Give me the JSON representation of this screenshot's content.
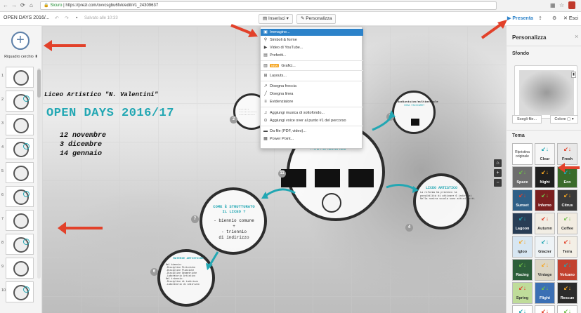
{
  "browser": {
    "nav_icons": [
      "back-icon",
      "forward-icon",
      "reload-icon"
    ],
    "secure_label": "Sicuro",
    "url": "https://prezi.com/ovvcsgbu6fvk/edit/#1_24309637",
    "right_icons": [
      "extension-icon",
      "star-icon",
      "profile-icon"
    ]
  },
  "toolbar": {
    "doc_title": "OPEN DAYS 2016/...",
    "saved_text": "Salvato alle 10:33",
    "insert_label": "Inserisci",
    "customize_label": "Personalizza",
    "present_label": "Presenta",
    "exit_label": "Esci"
  },
  "left_panel": {
    "add_icon": "+",
    "frame_label": "Riquadro cerchio",
    "frame_caret": "⬍",
    "thumb_numbers": [
      "1",
      "2",
      "3",
      "4",
      "5",
      "6",
      "7",
      "8",
      "9",
      "10"
    ]
  },
  "canvas": {
    "school": "Liceo Artistico \"N. Valentini\"",
    "title": "OPEN DAYS 2016/17",
    "dates": [
      "12 novembre",
      "3 dicembre",
      "14 gennaio"
    ],
    "center_title": "MULTIMEDIALE",
    "structure_heading": [
      "COME È STRUTTURATO",
      "IL LICEO ?"
    ],
    "structure_lines": [
      "- biennio comune",
      "+",
      "- triennio",
      "di indirizzo"
    ],
    "artistic_title": "LICEO ARTISTICO",
    "artistic_text": [
      "La riforma ha previsto la",
      "possibilità di attivare 6 indirizzi",
      "",
      "Nella nostra scuola sono attivi tutti"
    ],
    "materie_title": "MATERIE ARTISTICHE",
    "materie_text": [
      "Nel biennio:",
      "-Discipline Pittoriche",
      "-Discipline Plastiche",
      "-Discipline Geometriche",
      "-Laboratorio Artistico",
      "",
      "Nel triennio:",
      "-Discipline di indirizzo",
      "-Laboratorio di indirizzo"
    ],
    "audio_title": "Audiovisivo/multimediale",
    "audio_sub": "COSA FACCIAMO?",
    "badges": [
      "2",
      "4",
      "6",
      "7",
      "8",
      "11"
    ]
  },
  "insert_menu": {
    "items": [
      {
        "icon": "image-icon",
        "glyph": "▣",
        "label": "Immagine..."
      },
      {
        "icon": "shapes-icon",
        "glyph": "⚲",
        "label": "Simboli & forme"
      },
      {
        "icon": "youtube-icon",
        "glyph": "▶",
        "label": "Video di YouTube..."
      },
      {
        "icon": "favorites-icon",
        "glyph": "▤",
        "label": "Preferiti..."
      },
      {
        "icon": "chart-icon",
        "glyph": "▥",
        "label": "Grafici..."
      },
      {
        "icon": "layouts-icon",
        "glyph": "⊞",
        "label": "Layouts..."
      },
      {
        "icon": "arrow-draw-icon",
        "glyph": "↗",
        "label": "Disegna freccia"
      },
      {
        "icon": "line-draw-icon",
        "glyph": "╱",
        "label": "Disegna linea"
      },
      {
        "icon": "highlighter-icon",
        "glyph": "≡",
        "label": "Evidenziatore"
      },
      {
        "icon": "music-icon",
        "glyph": "♫",
        "label": "Aggiungi musica di sottofondo..."
      },
      {
        "icon": "voiceover-icon",
        "glyph": "⊙",
        "label": "Aggiungi voice over al punto #1 del percorso"
      },
      {
        "icon": "file-icon",
        "glyph": "▬",
        "label": "Da file (PDF, video)..."
      },
      {
        "icon": "powerpoint-icon",
        "glyph": "▦",
        "label": "Power Point..."
      }
    ],
    "new_badge": "NEW"
  },
  "right_panel": {
    "title": "Personalizza",
    "close": "×",
    "background_label": "Sfondo",
    "choose_file": "Scegli file...",
    "color_label": "Colore",
    "theme_label": "Tema",
    "themes": [
      {
        "name": "Ripristina originale",
        "bg": "#ffffff",
        "fg": "#333333"
      },
      {
        "name": "Clear",
        "bg": "#f7f7f7",
        "fg": "#333333"
      },
      {
        "name": "Fresh",
        "bg": "#e8e8e8",
        "fg": "#222222"
      },
      {
        "name": "Space",
        "bg": "#6d6d6d",
        "fg": "#ffffff"
      },
      {
        "name": "Night",
        "bg": "#1f1f1f",
        "fg": "#ffffff"
      },
      {
        "name": "Eco",
        "bg": "#3a6b2a",
        "fg": "#ffffff"
      },
      {
        "name": "Sunset",
        "bg": "#2f5f86",
        "fg": "#ffffff"
      },
      {
        "name": "Inferno",
        "bg": "#7a1f1f",
        "fg": "#ffffff"
      },
      {
        "name": "Citrus",
        "bg": "#3a3a3a",
        "fg": "#ffffff"
      },
      {
        "name": "Lagoon",
        "bg": "#283d55",
        "fg": "#ffffff"
      },
      {
        "name": "Autumn",
        "bg": "#f1ede4",
        "fg": "#333333"
      },
      {
        "name": "Coffee",
        "bg": "#f2ece1",
        "fg": "#333333"
      },
      {
        "name": "Igloo",
        "bg": "#d7e6f2",
        "fg": "#333333"
      },
      {
        "name": "Glacier",
        "bg": "#eef3f6",
        "fg": "#333333"
      },
      {
        "name": "Terra",
        "bg": "#f3efe6",
        "fg": "#333333"
      },
      {
        "name": "Racing",
        "bg": "#2d5e3a",
        "fg": "#ffffff"
      },
      {
        "name": "Vintage",
        "bg": "#dcd6c5",
        "fg": "#333333"
      },
      {
        "name": "Volcano",
        "bg": "#c2412f",
        "fg": "#ffffff"
      },
      {
        "name": "Spring",
        "bg": "#bfdc9a",
        "fg": "#333333"
      },
      {
        "name": "Flight",
        "bg": "#3b6fb4",
        "fg": "#ffffff"
      },
      {
        "name": "Rescue",
        "bg": "#2b2b2b",
        "fg": "#ffffff"
      },
      {
        "name": "",
        "bg": "#ffffff",
        "fg": "#333333"
      },
      {
        "name": "",
        "bg": "#ffffff",
        "fg": "#333333"
      },
      {
        "name": "",
        "bg": "#ffffff",
        "fg": "#333333"
      }
    ]
  },
  "colors": {
    "accent_cyan": "#22a7b3",
    "presenta_blue": "#2c82c9",
    "annotation_red": "#e2412a"
  }
}
